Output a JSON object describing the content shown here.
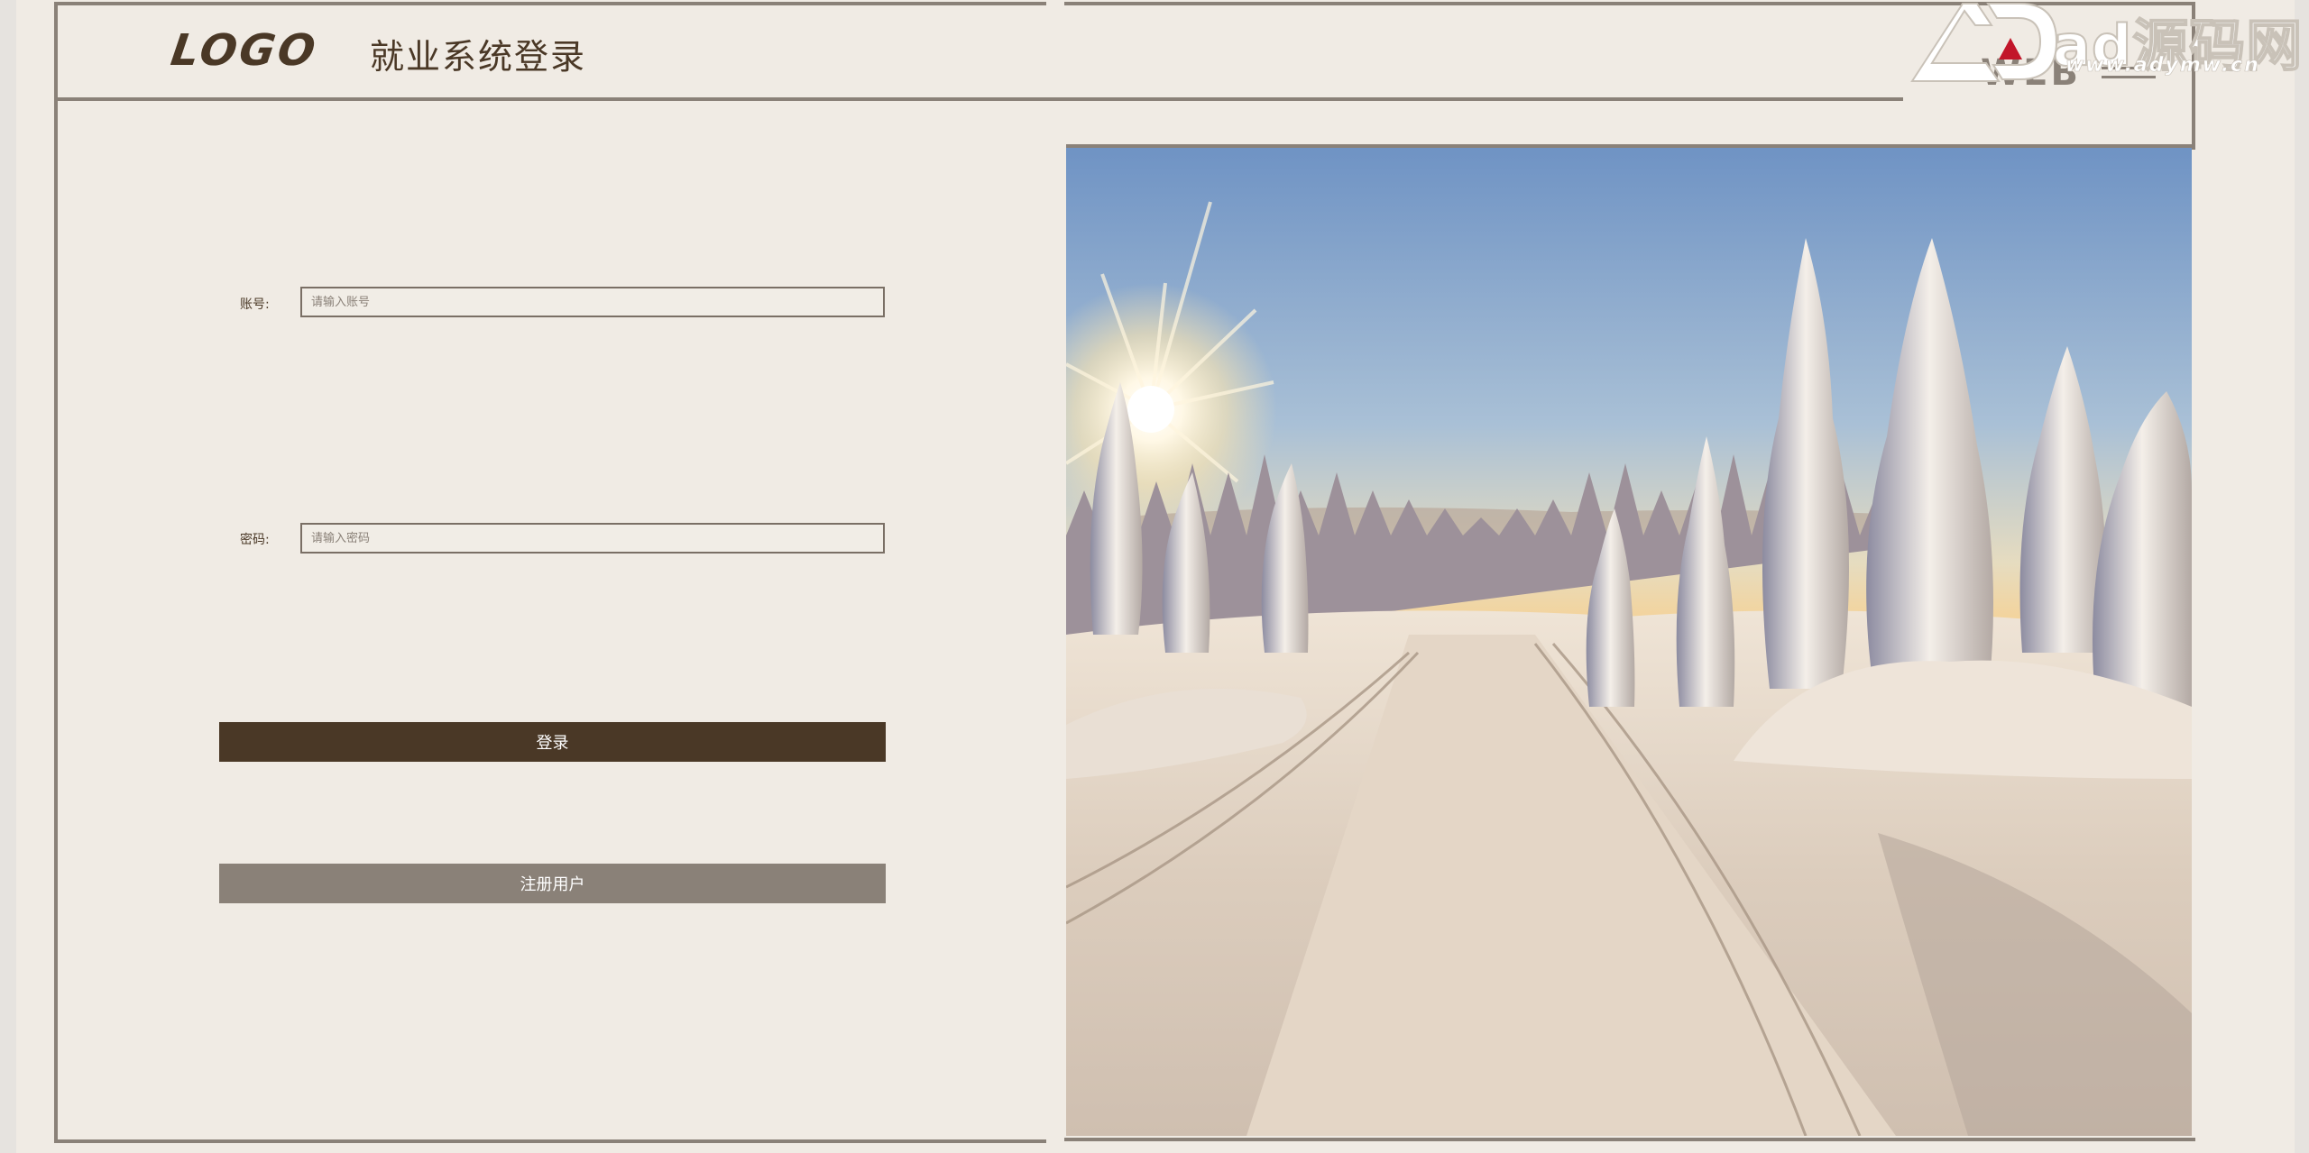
{
  "header": {
    "logo": "LOGO",
    "title": "就业系统登录",
    "web_text": "WEB"
  },
  "watermark": {
    "text": "ad源码网",
    "url": "www.adymw.cn"
  },
  "form": {
    "account_label": "账号:",
    "account_placeholder": "请输入账号",
    "account_value": "",
    "password_label": "密码:",
    "password_placeholder": "请输入密码",
    "password_value": "",
    "login_button": "登录",
    "register_button": "注册用户"
  },
  "colors": {
    "background": "#f0ebe4",
    "primary": "#4a3826",
    "secondary": "#8a8178"
  },
  "icons": {
    "menu": "hamburger-menu-icon",
    "watermark_logo": "ad-logo-icon"
  }
}
